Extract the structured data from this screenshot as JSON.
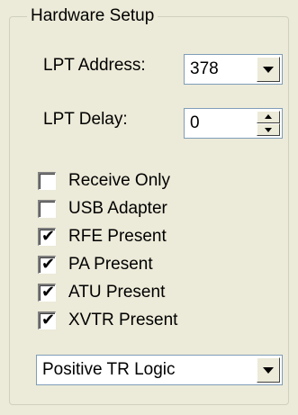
{
  "group": {
    "title": "Hardware Setup"
  },
  "lpt_address": {
    "label": "LPT Address:",
    "value": "378"
  },
  "lpt_delay": {
    "label": "LPT Delay:",
    "value": "0"
  },
  "checkboxes": [
    {
      "label": "Receive Only",
      "checked": false
    },
    {
      "label": "USB Adapter",
      "checked": false
    },
    {
      "label": "RFE Present",
      "checked": true
    },
    {
      "label": "PA Present",
      "checked": true
    },
    {
      "label": "ATU Present",
      "checked": true
    },
    {
      "label": "XVTR Present",
      "checked": true
    }
  ],
  "tr_logic": {
    "value": "Positive TR Logic"
  },
  "icons": {
    "dropdown": "chevron-down-icon",
    "spin_up": "spin-up-icon",
    "spin_down": "spin-down-icon",
    "check": "check-icon"
  },
  "colors": {
    "background": "#ecead8",
    "field_border": "#7f9db9"
  }
}
